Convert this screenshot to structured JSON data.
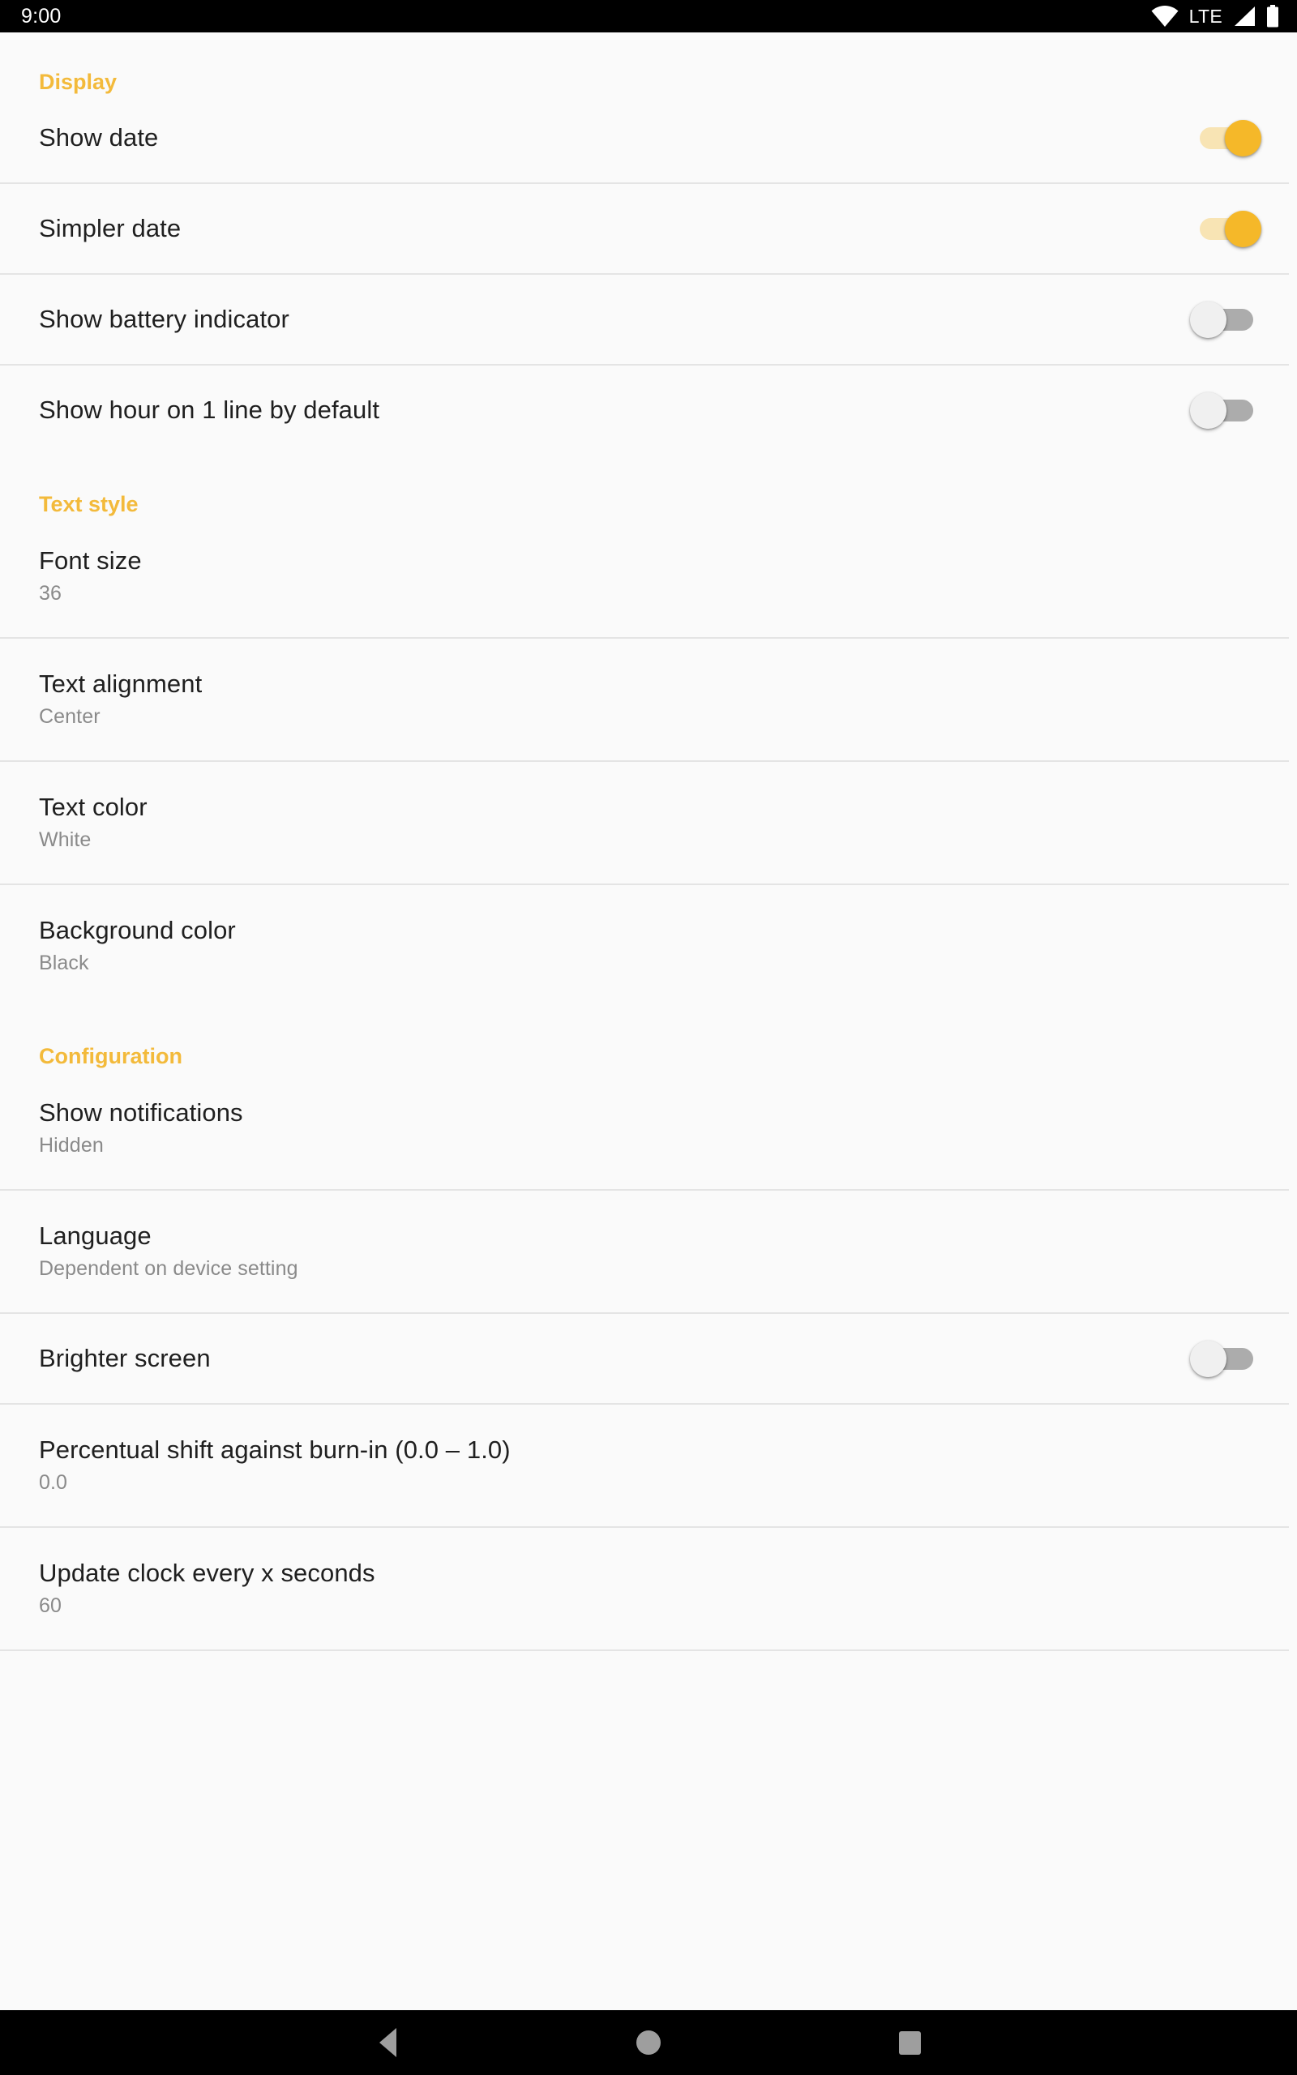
{
  "status_bar": {
    "time": "9:00",
    "network_label": "LTE",
    "icons": [
      "wifi-icon",
      "lte-label",
      "cellular-signal-icon",
      "battery-icon"
    ]
  },
  "colors": {
    "accent": "#F3BA3B",
    "toggle_on_thumb": "#F5B829",
    "toggle_on_track": "#F8E4B4",
    "toggle_off_track": "#ACACAC",
    "toggle_off_thumb": "#F0F0F0",
    "background": "#FAFAFA",
    "divider": "#E4E4E4",
    "title_text": "#1F1F1F",
    "summary_text": "#8A8A8A"
  },
  "sections": [
    {
      "title": "Display",
      "rows": [
        {
          "title": "Show date",
          "summary": null,
          "control": "switch",
          "value": "on"
        },
        {
          "title": "Simpler date",
          "summary": null,
          "control": "switch",
          "value": "on"
        },
        {
          "title": "Show battery indicator",
          "summary": null,
          "control": "switch",
          "value": "off"
        },
        {
          "title": "Show hour on 1 line by default",
          "summary": null,
          "control": "switch",
          "value": "off"
        }
      ]
    },
    {
      "title": "Text style",
      "rows": [
        {
          "title": "Font size",
          "summary": "36",
          "control": "none",
          "value": null
        },
        {
          "title": "Text alignment",
          "summary": "Center",
          "control": "none",
          "value": null
        },
        {
          "title": "Text color",
          "summary": "White",
          "control": "none",
          "value": null
        },
        {
          "title": "Background color",
          "summary": "Black",
          "control": "none",
          "value": null
        }
      ]
    },
    {
      "title": "Configuration",
      "rows": [
        {
          "title": "Show notifications",
          "summary": "Hidden",
          "control": "none",
          "value": null
        },
        {
          "title": "Language",
          "summary": "Dependent on device setting",
          "control": "none",
          "value": null
        },
        {
          "title": "Brighter screen",
          "summary": null,
          "control": "switch",
          "value": "off"
        },
        {
          "title": "Percentual shift against burn-in (0.0 – 1.0)",
          "summary": "0.0",
          "control": "none",
          "value": null
        },
        {
          "title": "Update clock every x seconds",
          "summary": "60",
          "control": "none",
          "value": null
        }
      ]
    }
  ],
  "nav_bar": {
    "back_label": "Back",
    "home_label": "Home",
    "recents_label": "Recents"
  }
}
